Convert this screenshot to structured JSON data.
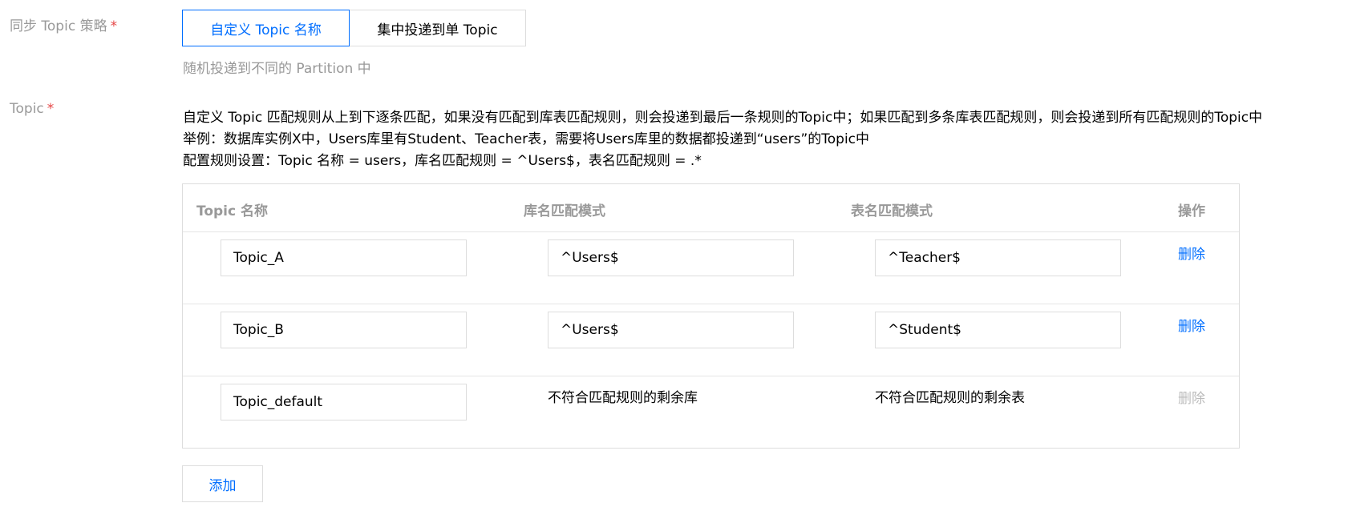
{
  "sync_strategy": {
    "label": "同步 Topic 策略",
    "required_mark": "*",
    "options": [
      "自定义 Topic 名称",
      "集中投递到单 Topic"
    ],
    "selected": "自定义 Topic 名称",
    "hint": "随机投递到不同的 Partition 中"
  },
  "topic": {
    "label": "Topic",
    "required_mark": "*",
    "description": [
      "自定义 Topic 匹配规则从上到下逐条匹配，如果没有匹配到库表匹配规则，则会投递到最后一条规则的Topic中；如果匹配到多条库表匹配规则，则会投递到所有匹配规则的Topic中",
      "举例：数据库实例X中，Users库里有Student、Teacher表，需要将Users库里的数据都投递到“users”的Topic中",
      "配置规则设置：Topic 名称 = users，库名匹配规则 = ^Users$，表名匹配规则 = .*"
    ]
  },
  "rules_table": {
    "columns": [
      "Topic 名称",
      "库名匹配模式",
      "表名匹配模式",
      "操作"
    ],
    "rows": [
      {
        "topic_name": "Topic_A",
        "db_pattern": "^Users$",
        "table_pattern": "^Teacher$",
        "action": "删除"
      },
      {
        "topic_name": "Topic_B",
        "db_pattern": "^Users$",
        "table_pattern": "^Student$",
        "action": "删除"
      },
      {
        "topic_name": "Topic_default",
        "db_pattern": "不符合匹配规则的剩余库",
        "table_pattern": "不符合匹配规则的剩余表",
        "action": "删除"
      }
    ]
  },
  "add_button": "添加",
  "colors": {
    "accent": "#006eff",
    "label_gray": "#999999",
    "required_red": "#e54545",
    "border": "#dddddd",
    "disabled": "#bbbbbb"
  }
}
